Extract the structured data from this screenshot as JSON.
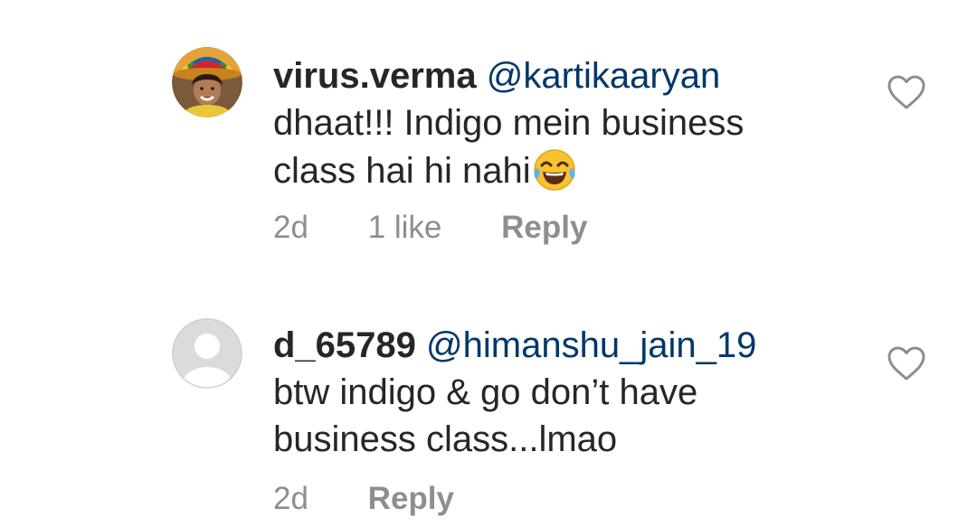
{
  "comments": [
    {
      "username": "virus.verma",
      "mention": "@kartikaaryan",
      "text_line1": "dhaat!!! Indigo mein business",
      "text_line2": "class hai hi nahi",
      "emoji": "face-with-tears-of-joy",
      "time": "2d",
      "likes": "1 like",
      "reply_label": "Reply",
      "avatar": "user-photo-avatar"
    },
    {
      "username": "d_65789",
      "mention": "@himanshu_jain_19",
      "text_line1": "btw indigo & go don’t have",
      "text_line2": "business class...lmao",
      "time": "2d",
      "reply_label": "Reply",
      "avatar": "default-avatar"
    }
  ],
  "colors": {
    "text": "#262626",
    "mention": "#00376b",
    "meta": "#8e8e8e",
    "icon": "#8e8e8e"
  }
}
